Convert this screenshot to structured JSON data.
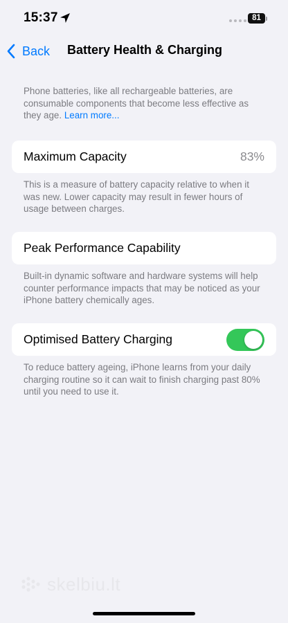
{
  "status_bar": {
    "time": "15:37",
    "battery_level": "81"
  },
  "nav": {
    "back_label": "Back",
    "title": "Battery Health & Charging"
  },
  "intro": {
    "text": "Phone batteries, like all rechargeable batteries, are consumable components that become less effective as they age. ",
    "link": "Learn more..."
  },
  "maximum_capacity": {
    "label": "Maximum Capacity",
    "value": "83%",
    "footnote": "This is a measure of battery capacity relative to when it was new. Lower capacity may result in fewer hours of usage between charges."
  },
  "peak_performance": {
    "label": "Peak Performance Capability",
    "footnote": "Built-in dynamic software and hardware systems will help counter performance impacts that may be noticed as your iPhone battery chemically ages."
  },
  "optimised_charging": {
    "label": "Optimised Battery Charging",
    "enabled": true,
    "footnote": "To reduce battery ageing, iPhone learns from your daily charging routine so it can wait to finish charging past 80% until you need to use it."
  },
  "watermark": {
    "text": "skelbiu.lt"
  },
  "colors": {
    "accent": "#007aff",
    "toggle_on": "#34c759",
    "background": "#f2f2f7"
  }
}
